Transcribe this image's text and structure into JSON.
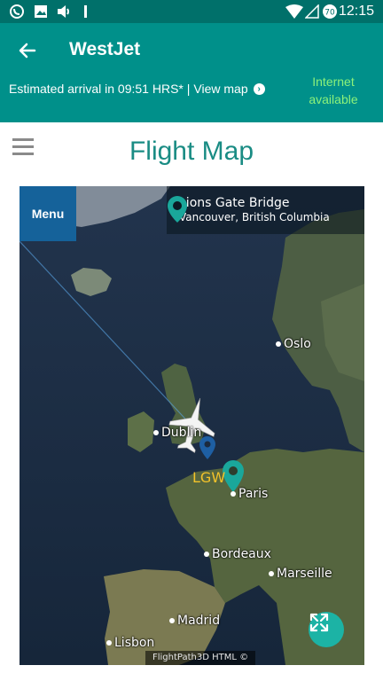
{
  "status_bar": {
    "time": "12:15",
    "battery_level": "70",
    "icons": [
      "viber-icon",
      "image-icon",
      "volume-icon",
      "sim-icon",
      "wifi-icon",
      "signal-icon",
      "battery-icon"
    ]
  },
  "app_bar": {
    "title": "WestJet",
    "eta_text": "Estimated arrival in 09:51 HRS* |",
    "view_map_label": "View map",
    "internet_status": "Internet available",
    "colors": {
      "bar": "#00908a",
      "status_bar": "#00706a",
      "internet_text": "#8cf27a"
    }
  },
  "page": {
    "title": "Flight Map",
    "title_color": "#1a8c84"
  },
  "map": {
    "menu_label": "Menu",
    "location_name": "Lions Gate Bridge",
    "location_sub": "Vancouver, British Columbia",
    "airport_code": "LGW",
    "credit": "FlightPath3D HTML ©",
    "cities": [
      "Oslo",
      "Dublin",
      "Paris",
      "Bordeaux",
      "Marseille",
      "Madrid",
      "Lisbon"
    ]
  }
}
